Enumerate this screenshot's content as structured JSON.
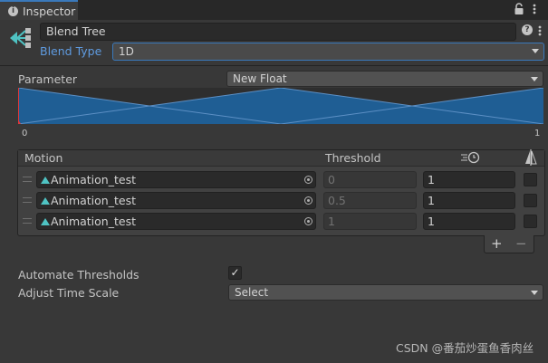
{
  "tab": {
    "title": "Inspector",
    "info_icon": "info-icon"
  },
  "header": {
    "name": "Blend Tree",
    "blend_type_label": "Blend Type",
    "blend_type_value": "1D",
    "help_glyph": "?"
  },
  "parameter": {
    "label": "Parameter",
    "value": "New Float",
    "axis_min": "0",
    "axis_max": "1"
  },
  "motion_list": {
    "header_motion": "Motion",
    "header_threshold": "Threshold",
    "rows": [
      {
        "motion": "Animation_test",
        "threshold": "0",
        "speed": "1",
        "mirror": false
      },
      {
        "motion": "Animation_test",
        "threshold": "0.5",
        "speed": "1",
        "mirror": false
      },
      {
        "motion": "Animation_test",
        "threshold": "1",
        "speed": "1",
        "mirror": false
      }
    ],
    "add_label": "+",
    "remove_label": "−"
  },
  "options": {
    "automate_thresholds_label": "Automate Thresholds",
    "automate_thresholds_checked": true,
    "check_glyph": "✓",
    "adjust_time_scale_label": "Adjust Time Scale",
    "adjust_time_scale_value": "Select"
  },
  "watermark": "CSDN @番茄炒蛋鱼香肉丝",
  "colors": {
    "accent": "#3a79bb",
    "blend_fill": "#1f5e94",
    "blend_line": "#5c8fc4",
    "marker": "#e0373a",
    "object_icon": "#4fc3c3"
  }
}
